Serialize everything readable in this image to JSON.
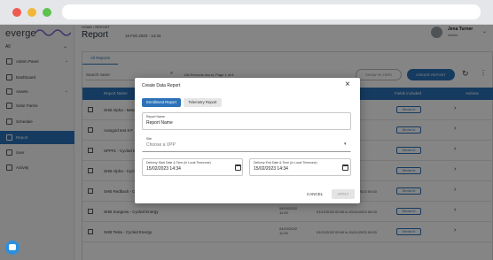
{
  "app": {
    "logo": "everge",
    "site_filter": "All",
    "breadcrumb": "HOME  /  REPORT",
    "page_title": "Report",
    "page_date": "15 Feb 2023 - 14:34",
    "user": {
      "name": "Jena Turner",
      "role": "Admin"
    }
  },
  "sidebar": {
    "items": [
      {
        "label": "Admin Panel",
        "icon": "admin-icon",
        "has_chevron": true
      },
      {
        "label": "Dashboard",
        "icon": "dashboard-icon",
        "has_chevron": false
      },
      {
        "label": "Assets",
        "icon": "assets-icon",
        "has_chevron": true
      },
      {
        "label": "Solar Farms",
        "icon": "solar-icon",
        "has_chevron": false
      },
      {
        "label": "Schedule",
        "icon": "schedule-icon",
        "has_chevron": false
      },
      {
        "label": "Report",
        "icon": "report-icon",
        "has_chevron": false,
        "active": true
      },
      {
        "label": "User",
        "icon": "user-icon",
        "has_chevron": false
      },
      {
        "label": "Activity",
        "icon": "activity-icon",
        "has_chevron": false
      }
    ]
  },
  "toolbar": {
    "tab_all": "All Reports",
    "search_placeholder": "Search name",
    "showing": "136 Records found, Page 1 of 8",
    "show_filters": "SHOW FILTERS",
    "create_report": "CREATE REPORT"
  },
  "table": {
    "headers": [
      "Report Name",
      "Fields included",
      "Actions"
    ],
    "rows": [
      {
        "name": "SHB Alpha - Meter",
        "date": "",
        "range": "01/12/2022 14:56",
        "field": "Device Id"
      },
      {
        "name": "Autogrid test 8 F",
        "date": "",
        "range": "",
        "field": "Device Id"
      },
      {
        "name": "SPP#1 - Cycled E",
        "date": "",
        "range": "",
        "field": "Device Id"
      },
      {
        "name": "SHB Alpha - Cycl",
        "date": "",
        "range": "",
        "field": "Device Id"
      },
      {
        "name": "SHB Redback - Cycled Energy",
        "date": "04/10/2022 11:25",
        "range": "01/12/2022 00:00 to 01/01/2023 00:00",
        "field": "Device Id"
      },
      {
        "name": "SHB Sungrow - Cycled Energy",
        "date": "04/10/2022 11:25",
        "range": "01/12/2022 00:00 to 01/01/2023 00:00",
        "field": "Device Id"
      },
      {
        "name": "SHB Tesla - Cycled Energy",
        "date": "04/10/2022 11:25",
        "range": "01/12/2022 00:00 to 01/01/2023 00:00",
        "field": "Device Id"
      }
    ]
  },
  "modal": {
    "title": "Create Data Report",
    "tabs": [
      "Enrollment Report",
      "Telemetry Report"
    ],
    "active_tab": 0,
    "report_name": {
      "label": "Report Name",
      "value": "Report Name"
    },
    "site": {
      "label": "Site",
      "placeholder": "Choose a VPP"
    },
    "start": {
      "label": "Delivery Start Date & Time (in Local Timezone)",
      "value": "15/02/2023 14:34"
    },
    "end": {
      "label": "Delivery End Date & Time (in Local Timezone)",
      "value": "15/02/2023 14:34"
    },
    "cancel": "CANCEL",
    "apply": "APPLY"
  },
  "colors": {
    "primary": "#2b72b8",
    "overlay": "rgba(0,0,0,0.48)"
  }
}
